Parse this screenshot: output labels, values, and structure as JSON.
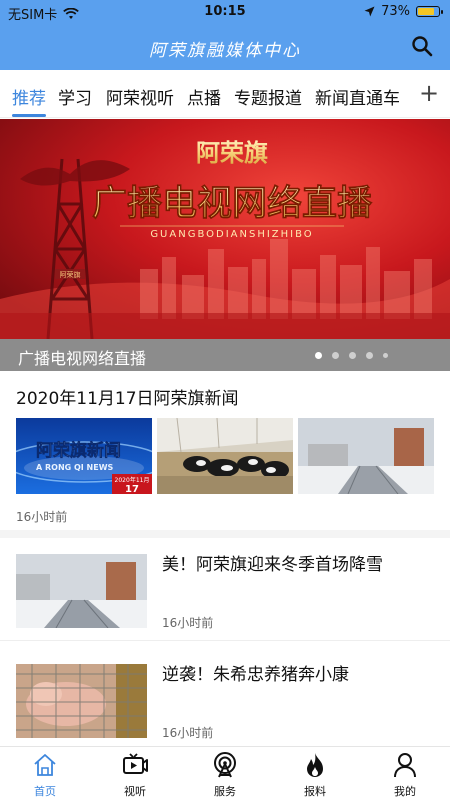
{
  "status_bar": {
    "carrier": "无SIM卡",
    "time": "10:15",
    "battery": "73%",
    "battery_level": 0.73
  },
  "header": {
    "brand": "阿荣旗融媒体中心",
    "search_icon": "search-icon"
  },
  "tabs": [
    {
      "label": "推荐",
      "active": true
    },
    {
      "label": "学习"
    },
    {
      "label": "阿荣视听"
    },
    {
      "label": "点播"
    },
    {
      "label": "专题报道"
    },
    {
      "label": "新闻直通车"
    }
  ],
  "tabs_add": "+",
  "banner": {
    "top_text": "阿荣旗",
    "headline": "广播电视网络直播",
    "pinyin": "GUANGBODIANSHIZHIBO",
    "tower_label": "阿荣旗",
    "caption": "广播电视网络直播",
    "slide_count": 5,
    "active_slide": 0
  },
  "news_group": {
    "title": "2020年11月17日阿荣旗新闻",
    "thumb1_title": "阿荣旗新闻",
    "thumb1_sub": "A RONG QI NEWS",
    "thumb1_date": "2020年11月",
    "thumb1_day": "17",
    "time": "16小时前"
  },
  "articles": [
    {
      "title": "美！阿荣旗迎来冬季首场降雪",
      "time": "16小时前"
    },
    {
      "title": "逆袭！朱希忠养猪奔小康",
      "time": "16小时前"
    }
  ],
  "bottom_nav": [
    {
      "label": "首页",
      "icon": "home-icon",
      "active": true
    },
    {
      "label": "视听",
      "icon": "tv-icon"
    },
    {
      "label": "服务",
      "icon": "antenna-icon"
    },
    {
      "label": "报料",
      "icon": "flame-icon"
    },
    {
      "label": "我的",
      "icon": "person-icon"
    }
  ],
  "colors": {
    "header": "#5aa0ee",
    "accent": "#3d86dd",
    "banner_red": "#c0161b"
  }
}
